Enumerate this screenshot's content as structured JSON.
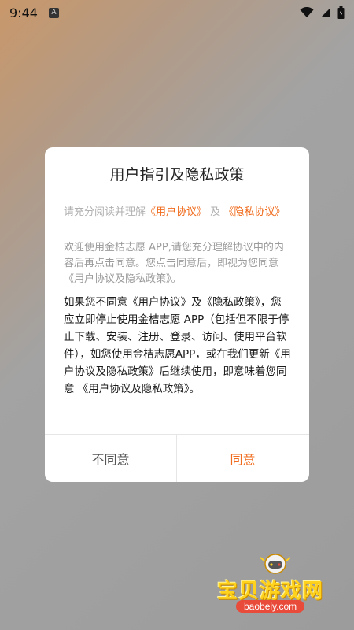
{
  "status_bar": {
    "time": "9:44",
    "notification_icon": "A"
  },
  "dialog": {
    "title": "用户指引及隐私政策",
    "intro_prefix": "请充分阅读并理解",
    "intro_link1": "《用户协议》",
    "intro_mid": "及",
    "intro_link2": "《隐私协议》",
    "welcome_text": "欢迎使用金桔志愿 APP,请您充分理解协议中的内容后再点击同意。您点击同意后，即视为您同意《用户协议及隐私政策》。",
    "warning_text": "如果您不同意《用户协议》及《隐私政策》，您应立即停止使用金桔志愿 APP（包括但不限于停止下载、安装、注册、登录、访问、使用平台软件），如您使用金桔志愿APP，或在我们更新《用户协议及隐私政策》后继续使用，即意味着您同意 《用户协议及隐私政策》。",
    "disagree_label": "不同意",
    "agree_label": "同意"
  },
  "watermark": {
    "text": "宝贝游戏网",
    "url": "baobeiy.com"
  },
  "colors": {
    "accent": "#f06c1e",
    "dialog_bg": "#ffffff"
  }
}
